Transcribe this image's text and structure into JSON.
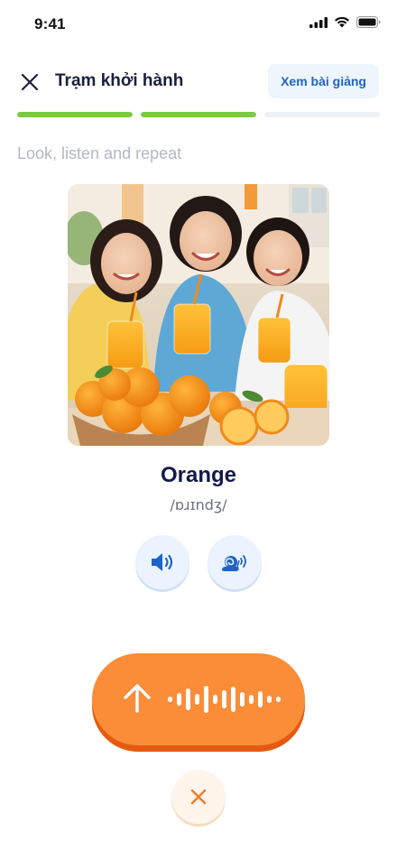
{
  "status_bar": {
    "time": "9:41",
    "icons": [
      "cellular-signal-icon",
      "wifi-icon",
      "battery-icon"
    ]
  },
  "header": {
    "close_icon": "close-icon",
    "title": "Trạm khởi hành",
    "lesson_button": "Xem bài giảng"
  },
  "progress": {
    "segments": [
      1.0,
      1.0,
      0.0
    ],
    "color_done": "#7ac943",
    "color_track": "#eef1f4"
  },
  "instruction": "Look, listen and repeat",
  "card": {
    "image": "orange-photo",
    "word": "Orange",
    "phonetic": "/ɒɹɪndʒ/"
  },
  "audio": {
    "normal_icon": "speaker-icon",
    "slow_icon": "snail-speaker-icon",
    "accent": "#1f63c8"
  },
  "record": {
    "icon": "upload-arrow-icon",
    "wave_icon": "waveform-icon",
    "color": "#fb8c38"
  },
  "cancel": {
    "icon": "close-icon",
    "color": "#f07a2a"
  }
}
